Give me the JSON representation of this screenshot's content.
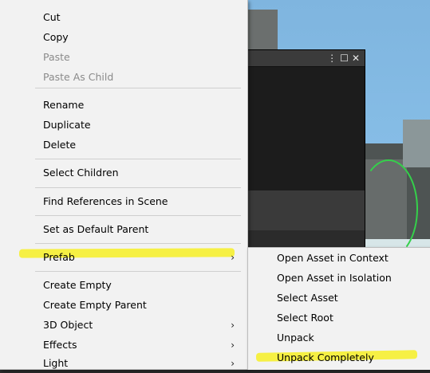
{
  "window_controls": {
    "kebab": "⋮",
    "maximize": "☐",
    "close": "✕"
  },
  "context_menu": {
    "items": [
      {
        "label": "Cut",
        "enabled": true
      },
      {
        "label": "Copy",
        "enabled": true
      },
      {
        "label": "Paste",
        "enabled": false
      },
      {
        "label": "Paste As Child",
        "enabled": false
      },
      {
        "label": "Rename",
        "enabled": true
      },
      {
        "label": "Duplicate",
        "enabled": true
      },
      {
        "label": "Delete",
        "enabled": true
      },
      {
        "label": "Select Children",
        "enabled": true
      },
      {
        "label": "Find References in Scene",
        "enabled": true
      },
      {
        "label": "Set as Default Parent",
        "enabled": true
      },
      {
        "label": "Prefab",
        "enabled": true,
        "submenu": true,
        "highlighted": true
      },
      {
        "label": "Create Empty",
        "enabled": true
      },
      {
        "label": "Create Empty Parent",
        "enabled": true
      },
      {
        "label": "3D Object",
        "enabled": true,
        "submenu": true
      },
      {
        "label": "Effects",
        "enabled": true,
        "submenu": true
      },
      {
        "label": "Light",
        "enabled": true,
        "submenu": true
      }
    ],
    "submenu_arrow": "›"
  },
  "prefab_submenu": {
    "items": [
      {
        "label": "Open Asset in Context"
      },
      {
        "label": "Open Asset in Isolation"
      },
      {
        "label": "Select Asset"
      },
      {
        "label": "Select Root"
      },
      {
        "label": "Unpack"
      },
      {
        "label": "Unpack Completely",
        "highlighted": true
      }
    ]
  },
  "colors": {
    "menu_bg": "#f2f2f2",
    "highlighter": "#f5ef3a",
    "disabled_text": "#8a8a8a",
    "panel_bg": "#1c1c1c"
  }
}
